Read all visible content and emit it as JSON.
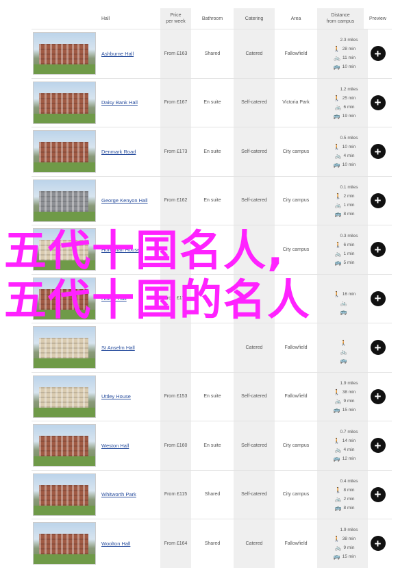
{
  "header": {
    "hall": "Hall",
    "price": "Price\nper week",
    "bathroom": "Bathroom",
    "catering": "Catering",
    "area": "Area",
    "distance": "Distance\nfrom campus",
    "preview": "Preview"
  },
  "icons": {
    "walk": "walk-icon",
    "bike": "bike-icon",
    "bus": "bus-icon",
    "preview": "plus-icon"
  },
  "rows": [
    {
      "hall": "Ashburne Hall",
      "price": "From £163",
      "bathroom": "Shared",
      "catering": "Catered",
      "area": "Fallowfield",
      "distance": "2.3 miles",
      "walk": "28 min",
      "bike": "11 min",
      "bus": "10 min",
      "photo": "red"
    },
    {
      "hall": "Daisy Bank Hall",
      "price": "From £167",
      "bathroom": "En suite",
      "catering": "Self-catered",
      "area": "Victoria Park",
      "distance": "1.2 miles",
      "walk": "25 min",
      "bike": "6 min",
      "bus": "19 min",
      "photo": "red"
    },
    {
      "hall": "Denmark Road",
      "price": "From £173",
      "bathroom": "En suite",
      "catering": "Self-catered",
      "area": "City campus",
      "distance": "0.5 miles",
      "walk": "10 min",
      "bike": "4 min",
      "bus": "10 min",
      "photo": "red"
    },
    {
      "hall": "George Kenyon Hall",
      "price": "From £162",
      "bathroom": "En suite",
      "catering": "Self-catered",
      "area": "City campus",
      "distance": "0.1 miles",
      "walk": "2 min",
      "bike": "1 min",
      "bus": "8 min",
      "photo": "grey"
    },
    {
      "hall": "Horniman House",
      "price": "",
      "bathroom": "",
      "catering": "",
      "area": "City campus",
      "distance": "0.3 miles",
      "walk": "6 min",
      "bike": "1 min",
      "bus": "5 min",
      "photo": "cream"
    },
    {
      "hall": "Hulme Hall",
      "price": "From £174",
      "bathroom": "",
      "catering": "",
      "area": "",
      "distance": "",
      "walk": "16 min",
      "bike": "",
      "bus": "",
      "photo": "red"
    },
    {
      "hall": "St Anselm Hall",
      "price": "",
      "bathroom": "",
      "catering": "Catered",
      "area": "Fallowfield",
      "distance": "",
      "walk": "",
      "bike": "",
      "bus": "",
      "photo": "cream"
    },
    {
      "hall": "Uttley House",
      "price": "From £153",
      "bathroom": "En suite",
      "catering": "Self-catered",
      "area": "Fallowfield",
      "distance": "1.9 miles",
      "walk": "38 min",
      "bike": "9 min",
      "bus": "15 min",
      "photo": "cream"
    },
    {
      "hall": "Weston Hall",
      "price": "From £160",
      "bathroom": "En suite",
      "catering": "Self-catered",
      "area": "City campus",
      "distance": "0.7 miles",
      "walk": "14 min",
      "bike": "4 min",
      "bus": "12 min",
      "photo": "red"
    },
    {
      "hall": "Whitworth Park",
      "price": "From £115",
      "bathroom": "Shared",
      "catering": "Self-catered",
      "area": "City campus",
      "distance": "0.4 miles",
      "walk": "8 min",
      "bike": "2 min",
      "bus": "8 min",
      "photo": "red"
    },
    {
      "hall": "Woolton Hall",
      "price": "From £164",
      "bathroom": "Shared",
      "catering": "Catered",
      "area": "Fallowfield",
      "distance": "1.9 miles",
      "walk": "38 min",
      "bike": "9 min",
      "bus": "15 min",
      "photo": "red"
    }
  ],
  "overlay": {
    "line1": "五代十国名人,",
    "line2": "五代十国的名人",
    "color": "#ff22ff"
  }
}
